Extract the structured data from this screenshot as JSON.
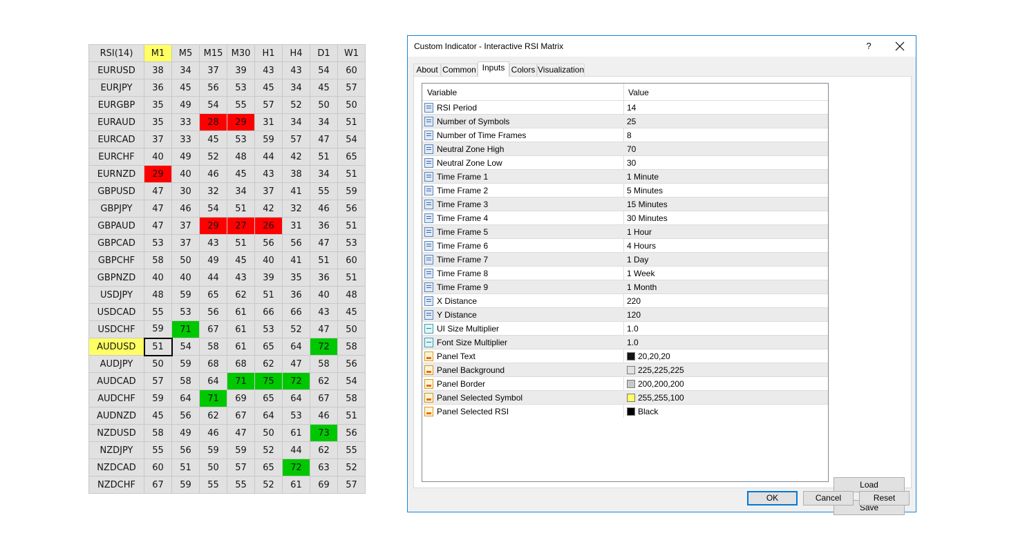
{
  "matrix": {
    "corner": "RSI(14)",
    "timeframes": [
      "M1",
      "M5",
      "M15",
      "M30",
      "H1",
      "H4",
      "D1",
      "W1"
    ],
    "selected_timeframe": "M1",
    "selected_symbol": "AUDUSD",
    "rows": [
      {
        "symbol": "EURUSD",
        "values": [
          38,
          34,
          37,
          39,
          43,
          43,
          54,
          60
        ]
      },
      {
        "symbol": "EURJPY",
        "values": [
          36,
          45,
          56,
          53,
          45,
          34,
          45,
          57
        ]
      },
      {
        "symbol": "EURGBP",
        "values": [
          35,
          49,
          54,
          55,
          57,
          52,
          50,
          50
        ]
      },
      {
        "symbol": "EURAUD",
        "values": [
          35,
          33,
          28,
          29,
          31,
          34,
          34,
          51
        ]
      },
      {
        "symbol": "EURCAD",
        "values": [
          37,
          33,
          45,
          53,
          59,
          57,
          47,
          54
        ]
      },
      {
        "symbol": "EURCHF",
        "values": [
          40,
          49,
          52,
          48,
          44,
          42,
          51,
          65
        ]
      },
      {
        "symbol": "EURNZD",
        "values": [
          29,
          40,
          46,
          45,
          43,
          38,
          34,
          51
        ]
      },
      {
        "symbol": "GBPUSD",
        "values": [
          47,
          30,
          32,
          34,
          37,
          41,
          55,
          59
        ]
      },
      {
        "symbol": "GBPJPY",
        "values": [
          47,
          46,
          54,
          51,
          42,
          32,
          46,
          56
        ]
      },
      {
        "symbol": "GBPAUD",
        "values": [
          47,
          37,
          29,
          27,
          26,
          31,
          36,
          51
        ]
      },
      {
        "symbol": "GBPCAD",
        "values": [
          53,
          37,
          43,
          51,
          56,
          56,
          47,
          53
        ]
      },
      {
        "symbol": "GBPCHF",
        "values": [
          58,
          50,
          49,
          45,
          40,
          41,
          51,
          60
        ]
      },
      {
        "symbol": "GBPNZD",
        "values": [
          40,
          40,
          44,
          43,
          39,
          35,
          36,
          51
        ]
      },
      {
        "symbol": "USDJPY",
        "values": [
          48,
          59,
          65,
          62,
          51,
          36,
          40,
          48
        ]
      },
      {
        "symbol": "USDCAD",
        "values": [
          55,
          53,
          56,
          61,
          66,
          66,
          43,
          45
        ]
      },
      {
        "symbol": "USDCHF",
        "values": [
          59,
          71,
          67,
          61,
          53,
          52,
          47,
          50
        ]
      },
      {
        "symbol": "AUDUSD",
        "values": [
          51,
          54,
          58,
          61,
          65,
          64,
          72,
          58
        ]
      },
      {
        "symbol": "AUDJPY",
        "values": [
          50,
          59,
          68,
          68,
          62,
          47,
          58,
          56
        ]
      },
      {
        "symbol": "AUDCAD",
        "values": [
          57,
          58,
          64,
          71,
          75,
          72,
          62,
          54
        ]
      },
      {
        "symbol": "AUDCHF",
        "values": [
          59,
          64,
          71,
          69,
          65,
          64,
          67,
          58
        ]
      },
      {
        "symbol": "AUDNZD",
        "values": [
          45,
          56,
          62,
          67,
          64,
          53,
          46,
          51
        ]
      },
      {
        "symbol": "NZDUSD",
        "values": [
          58,
          49,
          46,
          47,
          50,
          61,
          73,
          56
        ]
      },
      {
        "symbol": "NZDJPY",
        "values": [
          55,
          56,
          59,
          59,
          52,
          44,
          62,
          55
        ]
      },
      {
        "symbol": "NZDCAD",
        "values": [
          60,
          51,
          50,
          57,
          65,
          72,
          63,
          52
        ]
      },
      {
        "symbol": "NZDCHF",
        "values": [
          67,
          59,
          55,
          55,
          52,
          61,
          69,
          57
        ]
      }
    ],
    "neutral_low": 30,
    "neutral_high": 70,
    "colors": {
      "panel": "#e1e1e1",
      "border": "#c8c8c8",
      "text": "#141414",
      "selected": "#ffff64",
      "oversold": "#ff0000",
      "overbought": "#00c800"
    }
  },
  "dialog": {
    "title": "Custom Indicator - Interactive RSI Matrix",
    "help_label": "?",
    "tabs": [
      {
        "label": "About"
      },
      {
        "label": "Common"
      },
      {
        "label": "Inputs"
      },
      {
        "label": "Colors"
      },
      {
        "label": "Visualization"
      }
    ],
    "active_tab": "Inputs",
    "grid": {
      "col_variable": "Variable",
      "col_value": "Value",
      "rows": [
        {
          "name": "RSI Period",
          "value": "14",
          "type": "int"
        },
        {
          "name": "Number of Symbols",
          "value": "25",
          "type": "int"
        },
        {
          "name": "Number of Time Frames",
          "value": "8",
          "type": "int"
        },
        {
          "name": "Neutral Zone High",
          "value": "70",
          "type": "int"
        },
        {
          "name": "Neutral Zone Low",
          "value": "30",
          "type": "int"
        },
        {
          "name": "Time Frame 1",
          "value": "1 Minute",
          "type": "int"
        },
        {
          "name": "Time Frame 2",
          "value": "5 Minutes",
          "type": "int"
        },
        {
          "name": "Time Frame 3",
          "value": "15 Minutes",
          "type": "int"
        },
        {
          "name": "Time Frame 4",
          "value": "30 Minutes",
          "type": "int"
        },
        {
          "name": "Time Frame 5",
          "value": "1 Hour",
          "type": "int"
        },
        {
          "name": "Time Frame 6",
          "value": "4 Hours",
          "type": "int"
        },
        {
          "name": "Time Frame 7",
          "value": "1 Day",
          "type": "int"
        },
        {
          "name": "Time Frame 8",
          "value": "1 Week",
          "type": "int"
        },
        {
          "name": "Time Frame 9",
          "value": "1 Month",
          "type": "int"
        },
        {
          "name": "X Distance",
          "value": "220",
          "type": "int"
        },
        {
          "name": "Y Distance",
          "value": "120",
          "type": "int"
        },
        {
          "name": "UI Size Multiplier",
          "value": "1.0",
          "type": "double"
        },
        {
          "name": "Font Size Multiplier",
          "value": "1.0",
          "type": "double"
        },
        {
          "name": "Panel Text",
          "value": "20,20,20",
          "type": "color",
          "swatch": "#141414"
        },
        {
          "name": "Panel Background",
          "value": "225,225,225",
          "type": "color",
          "swatch": "#e1e1e1"
        },
        {
          "name": "Panel Border",
          "value": "200,200,200",
          "type": "color",
          "swatch": "#c8c8c8"
        },
        {
          "name": "Panel Selected Symbol",
          "value": "255,255,100",
          "type": "color",
          "swatch": "#ffff64"
        },
        {
          "name": "Panel Selected RSI",
          "value": "Black",
          "type": "color",
          "swatch": "#000000"
        }
      ]
    },
    "load_label": "Load",
    "save_label": "Save",
    "ok_label": "OK",
    "cancel_label": "Cancel",
    "reset_label": "Reset"
  }
}
